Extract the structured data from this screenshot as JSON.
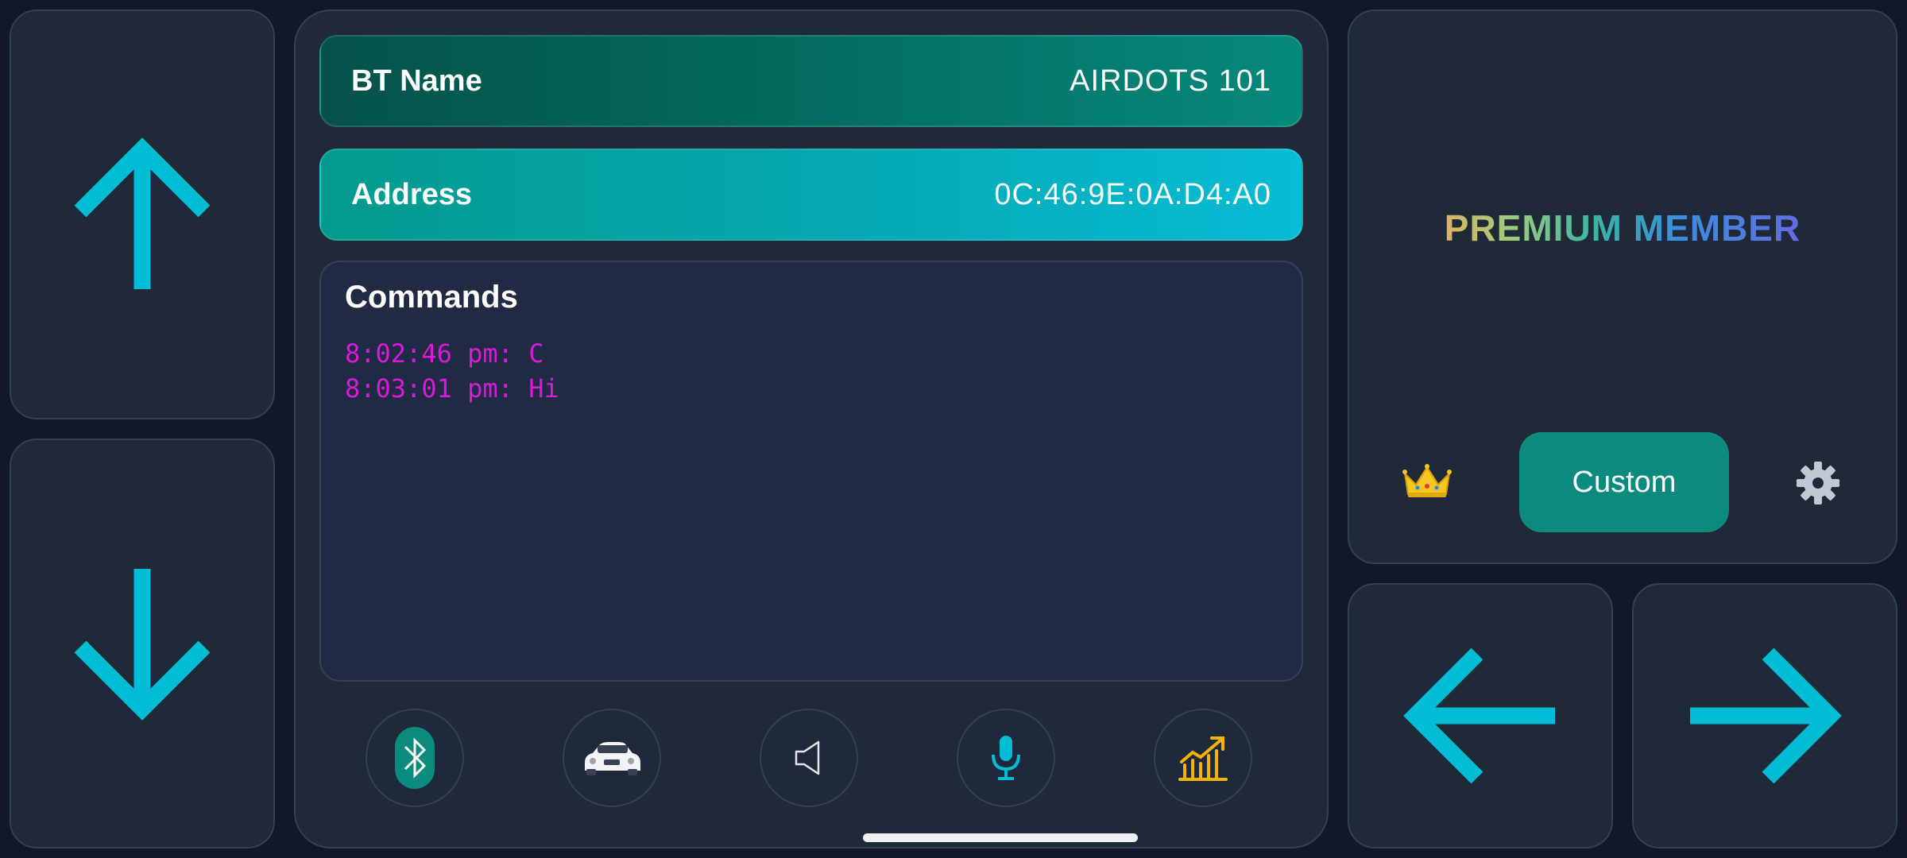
{
  "device": {
    "bt_name_label": "BT Name",
    "bt_name_value": "AIRDOTS 101",
    "address_label": "Address",
    "address_value": "0C:46:9E:0A:D4:A0"
  },
  "commands": {
    "title": "Commands",
    "log": [
      "8:02:46 pm: C",
      "8:03:01 pm: Hi"
    ]
  },
  "premium": {
    "title": "PREMIUM MEMBER",
    "custom_label": "Custom"
  },
  "icons": {
    "up": "arrow-up-icon",
    "down": "arrow-down-icon",
    "left": "arrow-left-icon",
    "right": "arrow-right-icon",
    "toolbar": [
      "bluetooth-icon",
      "car-icon",
      "speaker-icon",
      "microphone-icon",
      "chart-growth-icon"
    ],
    "crown": "crown-icon",
    "settings": "gear-icon"
  },
  "colors": {
    "accent": "#00bcd4",
    "teal": "#0a8b7e",
    "log_text": "#d91ad9",
    "chart_icon": "#f4b400"
  }
}
